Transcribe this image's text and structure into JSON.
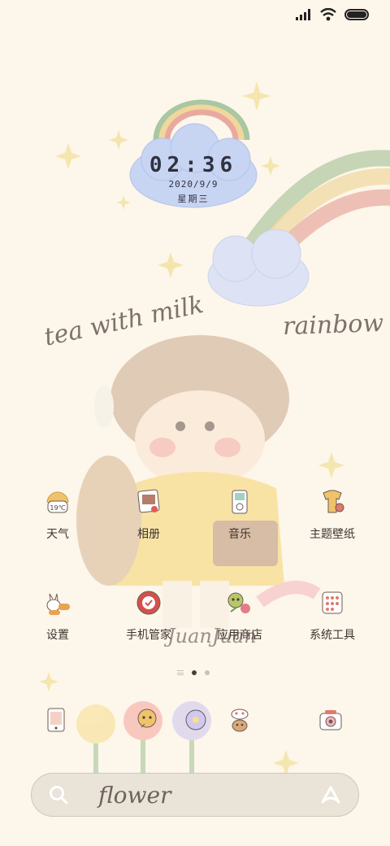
{
  "status_bar": {
    "icons": [
      "signal-icon",
      "wifi-icon",
      "battery-icon"
    ]
  },
  "clock": {
    "time": "02:36",
    "date": "2020/9/9",
    "weekday": "星期三"
  },
  "wallpaper_text": {
    "tea": "tea with milk",
    "rainbow": "rainbow",
    "juan": "JuanJuan"
  },
  "apps": [
    {
      "label": "天气",
      "icon": "weather-icon"
    },
    {
      "label": "相册",
      "icon": "gallery-icon"
    },
    {
      "label": "音乐",
      "icon": "music-icon"
    },
    {
      "label": "主题壁纸",
      "icon": "theme-icon"
    },
    {
      "label": "设置",
      "icon": "settings-icon"
    },
    {
      "label": "手机管家",
      "icon": "security-icon"
    },
    {
      "label": "应用商店",
      "icon": "app-store-icon"
    },
    {
      "label": "系统工具",
      "icon": "tools-icon"
    }
  ],
  "weather_icon_text": "19℃",
  "dock": {
    "icons": [
      "phone-icon",
      "messages-icon",
      "browser-icon",
      "contacts-icon",
      "camera-icon"
    ]
  },
  "page_indicator": {
    "current": 2,
    "total": 2
  },
  "search": {
    "text": "flower"
  },
  "colors": {
    "background": "#fdf6ea",
    "cloud": "#c7d4f2",
    "text": "#3e3430"
  }
}
